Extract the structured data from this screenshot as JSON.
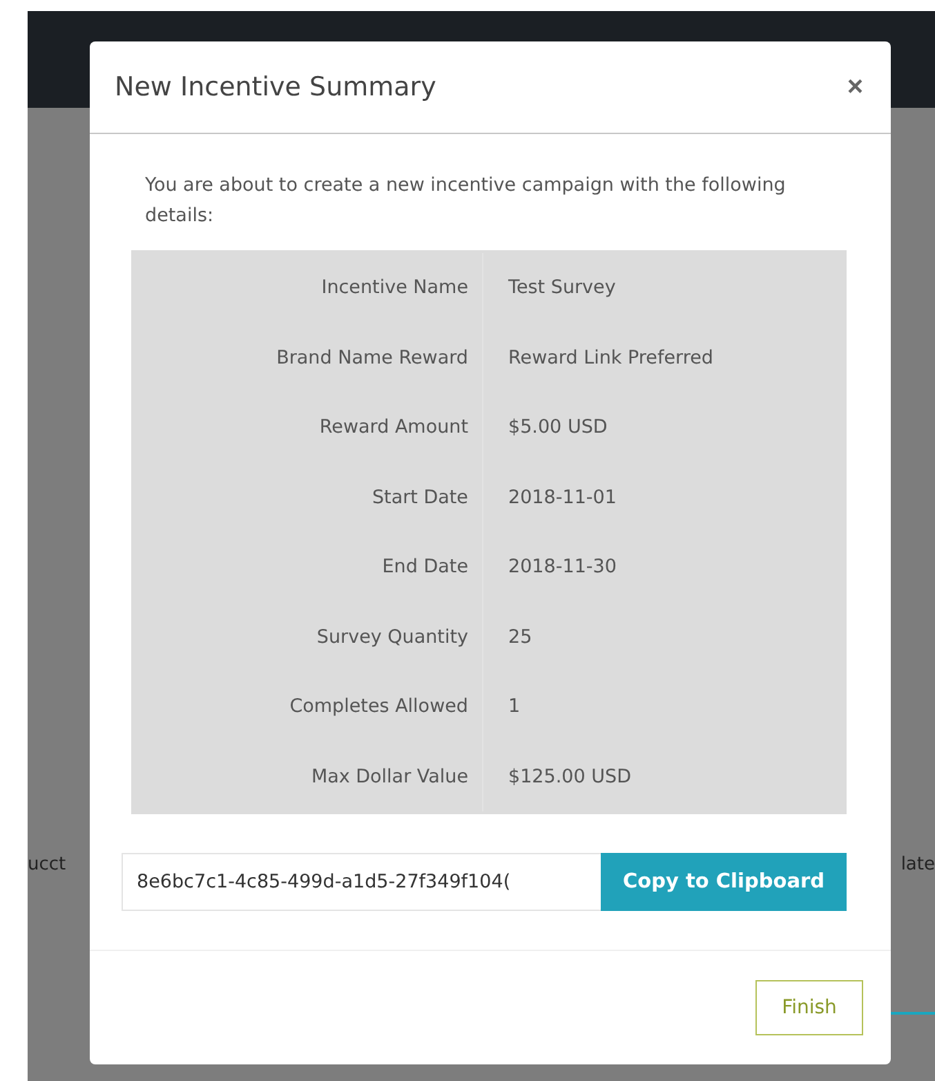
{
  "background": {
    "fragments": [
      "ucct",
      "late"
    ]
  },
  "dialog": {
    "title": "New Incentive Summary",
    "close": "×",
    "intro": "You are about to create a new incentive campaign with the following details:",
    "details": [
      {
        "label": "Incentive Name",
        "value": "Test Survey"
      },
      {
        "label": "Brand Name Reward",
        "value": "Reward Link Preferred"
      },
      {
        "label": "Reward Amount",
        "value": "$5.00 USD"
      },
      {
        "label": "Start Date",
        "value": "2018-11-01"
      },
      {
        "label": "End Date",
        "value": "2018-11-30"
      },
      {
        "label": "Survey Quantity",
        "value": "25"
      },
      {
        "label": "Completes Allowed",
        "value": "1"
      },
      {
        "label": "Max Dollar Value",
        "value": "$125.00 USD"
      }
    ],
    "link": {
      "value": "8e6bc7c1-4c85-499d-a1d5-27f349f104(",
      "button": "Copy to Clipboard"
    },
    "finish": "Finish"
  }
}
